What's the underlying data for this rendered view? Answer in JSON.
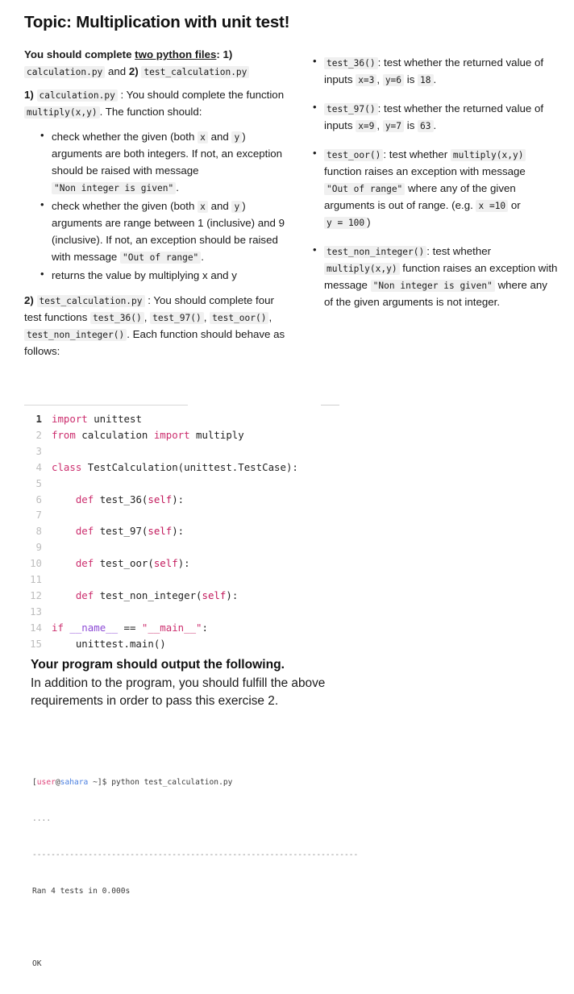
{
  "title": "Topic: Multiplication with unit test!",
  "intro": {
    "lead_bold": "You should complete",
    "lead_underline": "two python files",
    "after_underline": ": 1)",
    "file1": "calculation.py",
    "and": "and",
    "item2_num": "2)",
    "file2": "test_calculation.py"
  },
  "section1": {
    "num": "1)",
    "file": "calculation.py",
    "text_a": ": You should complete the function",
    "func": "multiply(x,y)",
    "text_b": ". The function should:",
    "bullets": [
      {
        "pre": "check whether the given (both",
        "code1": "x",
        "mid1": "and",
        "code2": "y",
        "mid2": ") arguments are both integers. If not, an exception should be raised with message",
        "code3": "\"Non integer is given\"",
        "post": "."
      },
      {
        "pre": "check whether the given (both",
        "code1": "x",
        "mid1": "and",
        "code2": "y",
        "mid2": ") arguments are range between 1 (inclusive) and 9 (inclusive). If not, an exception should be raised with message",
        "code3": "\"Out of range\"",
        "post": "."
      },
      {
        "plain": "returns the value by multiplying x and y"
      }
    ]
  },
  "section2": {
    "num": "2)",
    "file": "test_calculation.py",
    "text_a": ": You should complete four test functions",
    "fn1": "test_36()",
    "sep1": ",",
    "fn2": "test_97()",
    "sep2": ",",
    "fn3": "test_oor()",
    "sep3": ",",
    "fn4": "test_non_integer()",
    "text_b": ". Each function should behave as follows:"
  },
  "right_bullets": [
    {
      "fn": "test_36()",
      "t1": ": test whether the returned value of inputs",
      "c1": "x=3",
      "s1": ",",
      "c2": "y=6",
      "t2": "is",
      "c3": "18",
      "t3": "."
    },
    {
      "fn": "test_97()",
      "t1": ": test whether the returned value of inputs",
      "c1": "x=9",
      "s1": ",",
      "c2": "y=7",
      "t2": "is",
      "c3": "63",
      "t3": "."
    },
    {
      "fn": "test_oor()",
      "t1": ": test whether",
      "c1": "multiply(x,y)",
      "t2": "function raises an exception with message",
      "c2": "\"Out of range\"",
      "t3": "where any of the given arguments is out of range. (e.g.",
      "c3": "x =10",
      "t4": "or",
      "c4": "y = 100",
      "t5": ")"
    },
    {
      "fn": "test_non_integer()",
      "t1": ": test whether",
      "c1": "multiply(x,y)",
      "t2": "function raises an exception with message",
      "c2": "\"Non integer is given\"",
      "t3": "where any of the given arguments is not integer."
    }
  ],
  "code": {
    "language": "python",
    "lines": [
      {
        "n": "1",
        "tokens": [
          {
            "t": "import",
            "c": "kw"
          },
          {
            "t": " unittest",
            "c": ""
          }
        ]
      },
      {
        "n": "2",
        "tokens": [
          {
            "t": "from",
            "c": "kw"
          },
          {
            "t": " calculation ",
            "c": ""
          },
          {
            "t": "import",
            "c": "kw"
          },
          {
            "t": " multiply",
            "c": ""
          }
        ]
      },
      {
        "n": "3",
        "tokens": []
      },
      {
        "n": "4",
        "tokens": [
          {
            "t": "class",
            "c": "kw"
          },
          {
            "t": " TestCalculation(unittest.TestCase):",
            "c": ""
          }
        ]
      },
      {
        "n": "5",
        "tokens": []
      },
      {
        "n": "6",
        "tokens": [
          {
            "t": "    ",
            "c": ""
          },
          {
            "t": "def",
            "c": "kw"
          },
          {
            "t": " test_36(",
            "c": ""
          },
          {
            "t": "self",
            "c": "slf"
          },
          {
            "t": "):",
            "c": ""
          }
        ]
      },
      {
        "n": "7",
        "tokens": []
      },
      {
        "n": "8",
        "tokens": [
          {
            "t": "    ",
            "c": ""
          },
          {
            "t": "def",
            "c": "kw"
          },
          {
            "t": " test_97(",
            "c": ""
          },
          {
            "t": "self",
            "c": "slf"
          },
          {
            "t": "):",
            "c": ""
          }
        ]
      },
      {
        "n": "9",
        "tokens": []
      },
      {
        "n": "10",
        "tokens": [
          {
            "t": "    ",
            "c": ""
          },
          {
            "t": "def",
            "c": "kw"
          },
          {
            "t": " test_oor(",
            "c": ""
          },
          {
            "t": "self",
            "c": "slf"
          },
          {
            "t": "):",
            "c": ""
          }
        ]
      },
      {
        "n": "11",
        "tokens": []
      },
      {
        "n": "12",
        "tokens": [
          {
            "t": "    ",
            "c": ""
          },
          {
            "t": "def",
            "c": "kw"
          },
          {
            "t": " test_non_integer(",
            "c": ""
          },
          {
            "t": "self",
            "c": "slf"
          },
          {
            "t": "):",
            "c": ""
          }
        ]
      },
      {
        "n": "13",
        "tokens": []
      },
      {
        "n": "14",
        "tokens": [
          {
            "t": "if",
            "c": "kw"
          },
          {
            "t": " ",
            "c": ""
          },
          {
            "t": "__name__",
            "c": "nm"
          },
          {
            "t": " == ",
            "c": ""
          },
          {
            "t": "\"__main__\"",
            "c": "str"
          },
          {
            "t": ":",
            "c": ""
          }
        ]
      },
      {
        "n": "15",
        "tokens": [
          {
            "t": "    unittest.main()",
            "c": ""
          }
        ]
      }
    ]
  },
  "bottom": {
    "heading": "Your program should output the following.",
    "body": "In addition to the program, you should fulfill the above requirements in order to pass this exercise 2."
  },
  "terminal": {
    "prompt_open": "[",
    "user": "user",
    "at": "@",
    "host": "sahara",
    "prompt_close": " ~]$ ",
    "command": "python test_calculation.py",
    "dots": "....",
    "divider": "----------------------------------------------------------------------",
    "summary": "Ran 4 tests in 0.000s",
    "result": "OK"
  },
  "colors": {
    "keyword": "#cc2e6e",
    "self": "#c2185b",
    "name": "#8d4bd6",
    "string": "#cc2e6e",
    "inline_code_bg": "#f0f0f0",
    "term_user": "#e0457b",
    "term_host": "#4a7fe0"
  }
}
